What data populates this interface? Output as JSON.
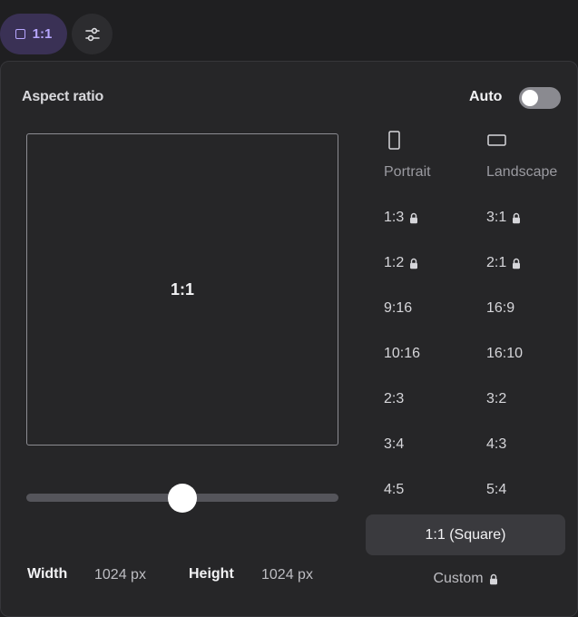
{
  "topbar": {
    "ratio_chip_label": "1:1",
    "settings_icon": "sliders-icon"
  },
  "panel": {
    "title": "Aspect ratio",
    "auto_label": "Auto",
    "auto_enabled": false,
    "preview_label": "1:1",
    "slider_value": 0.5,
    "width_label": "Width",
    "width_value": "1024 px",
    "height_label": "Height",
    "height_value": "1024 px",
    "portrait": {
      "heading": "Portrait",
      "icon": "portrait-rect-icon",
      "ratios": [
        {
          "label": "1:3",
          "locked": true
        },
        {
          "label": "1:2",
          "locked": true
        },
        {
          "label": "9:16",
          "locked": false
        },
        {
          "label": "10:16",
          "locked": false
        },
        {
          "label": "2:3",
          "locked": false
        },
        {
          "label": "3:4",
          "locked": false
        },
        {
          "label": "4:5",
          "locked": false
        }
      ]
    },
    "landscape": {
      "heading": "Landscape",
      "icon": "landscape-rect-icon",
      "ratios": [
        {
          "label": "3:1",
          "locked": true
        },
        {
          "label": "2:1",
          "locked": true
        },
        {
          "label": "16:9",
          "locked": false
        },
        {
          "label": "16:10",
          "locked": false
        },
        {
          "label": "3:2",
          "locked": false
        },
        {
          "label": "4:3",
          "locked": false
        },
        {
          "label": "5:4",
          "locked": false
        }
      ]
    },
    "square_button": "1:1 (Square)",
    "custom_label": "Custom",
    "custom_locked": true
  },
  "colors": {
    "background": "#1f1f21",
    "panel": "#262628",
    "accent": "#b7a6ff",
    "chip_bg": "#3a3155"
  }
}
